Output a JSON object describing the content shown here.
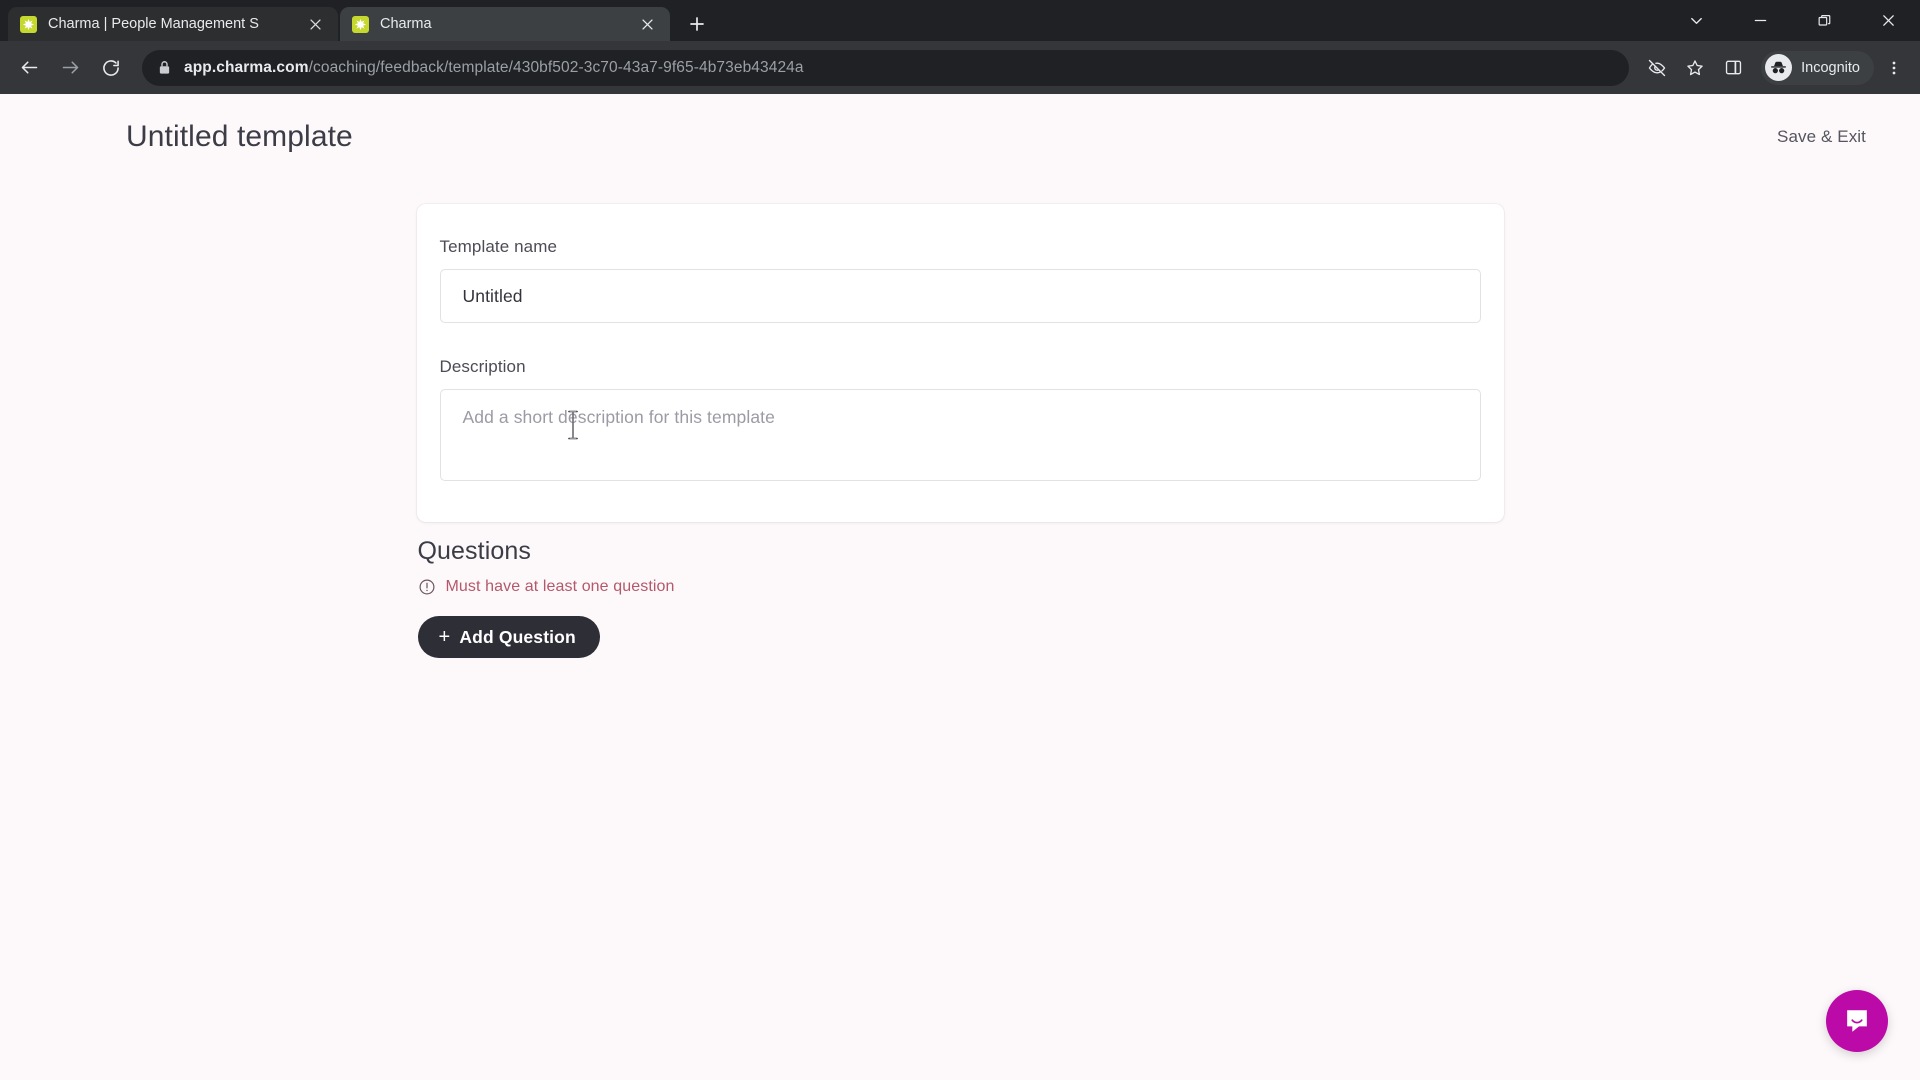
{
  "browser": {
    "tabs": [
      {
        "title": "Charma | People Management S",
        "favicon": "charma-star-icon",
        "active": false
      },
      {
        "title": "Charma",
        "favicon": "charma-star-icon",
        "active": true
      }
    ],
    "new_tab_label": "+",
    "window_controls": [
      "tab-search-chevron-icon",
      "minimize-icon",
      "restore-icon",
      "close-icon"
    ],
    "nav": {
      "back": "back-arrow-icon",
      "forward": "forward-arrow-icon",
      "reload": "reload-icon"
    },
    "omnibox": {
      "lock": "lock-icon",
      "url_host": "app.charma.com",
      "url_path": "/coaching/feedback/template/430bf502-3c70-43a7-9f65-4b73eb43424a"
    },
    "toolbar_icons": [
      "eye-slash-icon",
      "star-icon",
      "side-panel-icon"
    ],
    "profile": {
      "label": "Incognito",
      "avatar": "incognito-avatar-icon"
    },
    "menu": "three-dot-menu-icon"
  },
  "header": {
    "title": "Untitled template",
    "save_exit_label": "Save & Exit"
  },
  "form": {
    "template_name": {
      "label": "Template name",
      "value": "Untitled"
    },
    "description": {
      "label": "Description",
      "placeholder": "Add a short description for this template",
      "value": ""
    }
  },
  "questions": {
    "title": "Questions",
    "error": {
      "icon": "alert-circle-icon",
      "message": "Must have at least one question",
      "color": "#b4586c"
    },
    "add_button": {
      "plus": "+",
      "label": "Add Question"
    }
  },
  "support": {
    "launcher": "intercom-chat-icon",
    "color": "#bb0aa8"
  },
  "theme": {
    "page_background": "#fdf9fa",
    "card_background": "#ffffff",
    "button_dark": "#2e2e36",
    "favicon_green": "#c4d82e"
  }
}
